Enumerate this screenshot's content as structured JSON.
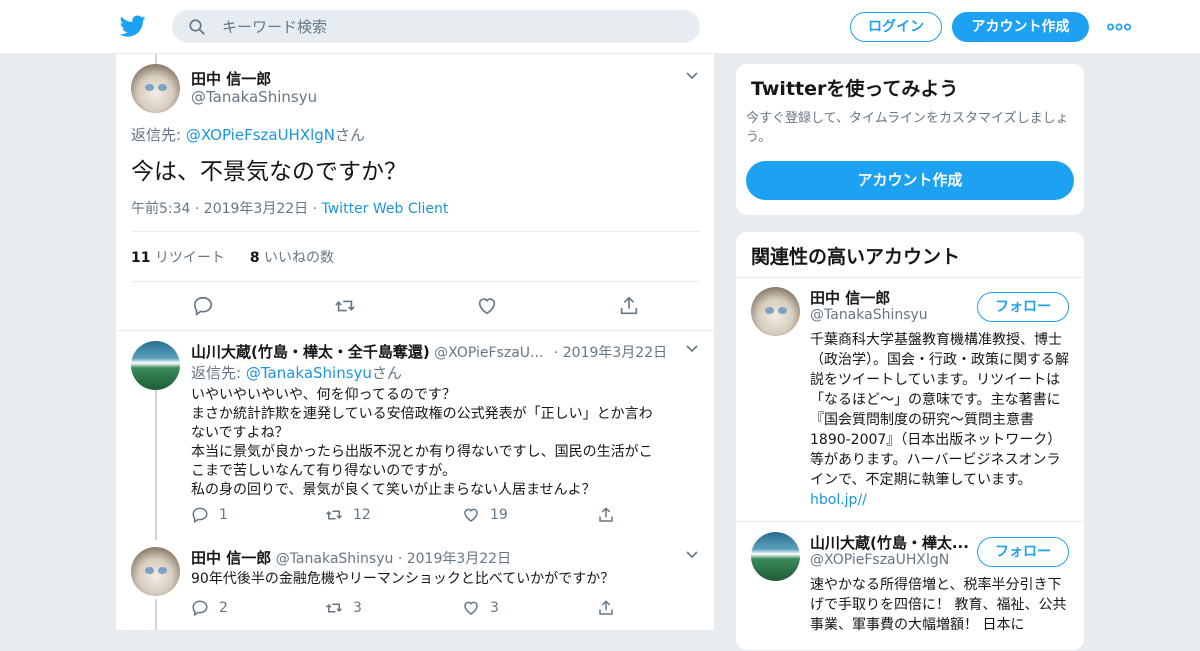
{
  "header": {
    "logo_icon": "twitter-bird-icon",
    "search_placeholder": "キーワード検索",
    "login_label": "ログイン",
    "signup_label": "アカウント作成",
    "more_icon": "more-dots-icon",
    "accent": "#1da1f2"
  },
  "focus_tweet": {
    "name": "田中 信一郎",
    "handle": "@TanakaShinsyu",
    "reply_prefix": "返信先: ",
    "reply_handle": "@XOPieFszaUHXlgN",
    "reply_suffix": "さん",
    "text": "今は、不景気なのですか？",
    "timestamp": "午前5:34 · 2019年3月22日",
    "meta_sep": " · ",
    "client": "Twitter Web Client",
    "retweets_count": "11",
    "retweets_label": "リツイート",
    "likes_count": "8",
    "likes_label": "いいねの数"
  },
  "replies": [
    {
      "name": "山川大蔵(竹島・樺太・全千島奪還)",
      "handle": "@XOPieFszaU...",
      "date": "· 2019年3月22日",
      "reply_prefix": "返信先: ",
      "reply_handle": "@TanakaShinsyu",
      "reply_suffix": "さん",
      "lines": [
        "いやいやいやいや、何を仰ってるのです？",
        "まさか統計詐欺を連発している安倍政権の公式発表が「正しい」とか言わ",
        "ないですよね？",
        "本当に景気が良かったら出版不況とか有り得ないですし、国民の生活がこ",
        "こまで苦しいなんて有り得ないのですが。",
        "私の身の回りで、景気が良くて笑いが止まらない人居ませんよ？"
      ],
      "replies_count": "1",
      "retweets_count": "12",
      "likes_count": "19"
    },
    {
      "name": "田中 信一郎",
      "handle": "@TanakaShinsyu",
      "date": "· 2019年3月22日",
      "lines": [
        "90年代後半の金融危機やリーマンショックと比べていかがですか？"
      ],
      "replies_count": "2",
      "retweets_count": "3",
      "likes_count": "3"
    }
  ],
  "sidebar": {
    "promo_title": "Twitterを使ってみよう",
    "promo_text": "今すぐ登録して、タイムラインをカスタマイズしましょう。",
    "promo_button": "アカウント作成",
    "related_title": "関連性の高いアカウント",
    "accounts": [
      {
        "name": "田中 信一郎",
        "handle": "@TanakaShinsyu",
        "follow_label": "フォロー",
        "bio": "千葉商科大学基盤教育機構准教授、博士（政治学）。国会・行政・政策に関する解説をツイートしています。リツイートは「なるほど〜」の意味です。主な著書に『国会質問制度の研究～質問主意書1890-2007』（日本出版ネットワーク）等があります。ハーバービジネスオンラインで、不定期に執筆しています。",
        "bio_link": "hbol.jp//"
      },
      {
        "name": "山川大蔵(竹島・樺太...",
        "handle": "@XOPieFszaUHXlgN",
        "follow_label": "フォロー",
        "bio": "速やかなる所得倍増と、税率半分引き下げで手取りを四倍に！ 教育、福祉、公共事業、軍事費の大幅増額！ 日本に"
      }
    ]
  }
}
